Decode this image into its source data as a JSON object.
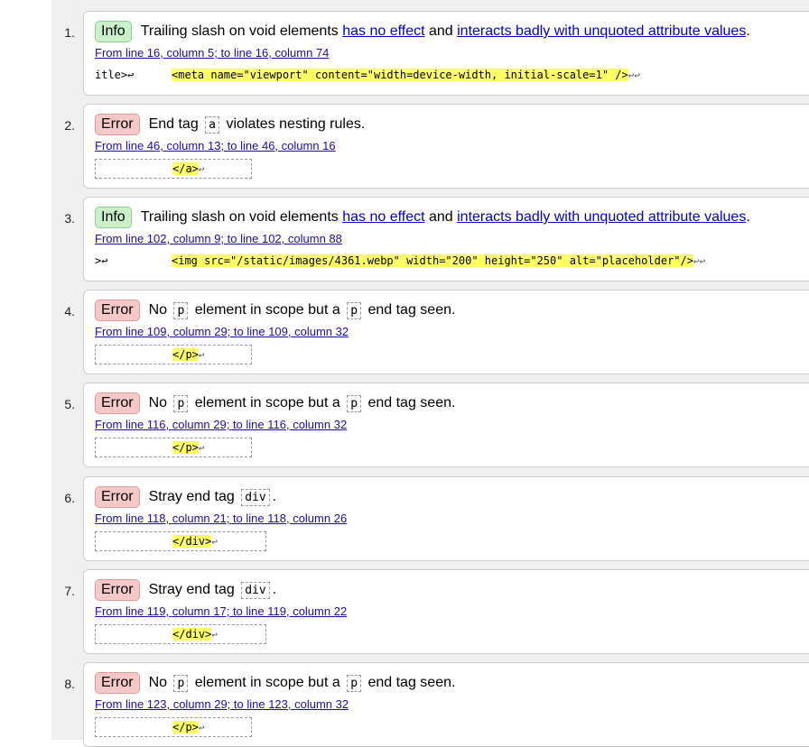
{
  "messages": [
    {
      "num": "1.",
      "type": "Info",
      "parts": [
        {
          "t": "Trailing slash on void elements "
        },
        {
          "t": "has no effect",
          "link": true
        },
        {
          "t": " and "
        },
        {
          "t": "interacts badly with unquoted attribute values",
          "link": true
        },
        {
          "t": "."
        }
      ],
      "location": "From line 16, column 5; to line 16, column 74",
      "pre": "itle>↩",
      "code": "<meta name=\"viewport\" content=\"width=device-width, initial-scale=1\" />",
      "post": "↩↩"
    },
    {
      "num": "2.",
      "type": "Error",
      "parts": [
        {
          "t": "End tag "
        },
        {
          "t": "a",
          "code": true
        },
        {
          "t": " violates nesting rules."
        }
      ],
      "location": "From line 46, column 13; to line 46, column 16",
      "pre": "",
      "code": "</a>",
      "post": "↩"
    },
    {
      "num": "3.",
      "type": "Info",
      "parts": [
        {
          "t": "Trailing slash on void elements "
        },
        {
          "t": "has no effect",
          "link": true
        },
        {
          "t": " and "
        },
        {
          "t": "interacts badly with unquoted attribute values",
          "link": true
        },
        {
          "t": "."
        }
      ],
      "location": "From line 102, column 9; to line 102, column 88",
      "pre": ">↩",
      "code": "<img src=\"/static/images/4361.webp\" width=\"200\" height=\"250\" alt=\"placeholder\"/>",
      "post": "↩↩"
    },
    {
      "num": "4.",
      "type": "Error",
      "parts": [
        {
          "t": "No "
        },
        {
          "t": "p",
          "code": true
        },
        {
          "t": " element in scope but a "
        },
        {
          "t": "p",
          "code": true
        },
        {
          "t": " end tag seen."
        }
      ],
      "location": "From line 109, column 29; to line 109, column 32",
      "pre": "",
      "code": "</p>",
      "post": "↩"
    },
    {
      "num": "5.",
      "type": "Error",
      "parts": [
        {
          "t": "No "
        },
        {
          "t": "p",
          "code": true
        },
        {
          "t": " element in scope but a "
        },
        {
          "t": "p",
          "code": true
        },
        {
          "t": " end tag seen."
        }
      ],
      "location": "From line 116, column 29; to line 116, column 32",
      "pre": "",
      "code": "</p>",
      "post": "↩"
    },
    {
      "num": "6.",
      "type": "Error",
      "parts": [
        {
          "t": "Stray end tag "
        },
        {
          "t": "div",
          "code": true
        },
        {
          "t": "."
        }
      ],
      "location": "From line 118, column 21; to line 118, column 26",
      "pre": "",
      "code": "</div>",
      "post": "↩"
    },
    {
      "num": "7.",
      "type": "Error",
      "parts": [
        {
          "t": "Stray end tag "
        },
        {
          "t": "div",
          "code": true
        },
        {
          "t": "."
        }
      ],
      "location": "From line 119, column 17; to line 119, column 22",
      "pre": "",
      "code": "</div>",
      "post": "↩"
    },
    {
      "num": "8.",
      "type": "Error",
      "parts": [
        {
          "t": "No "
        },
        {
          "t": "p",
          "code": true
        },
        {
          "t": " element in scope but a "
        },
        {
          "t": "p",
          "code": true
        },
        {
          "t": " end tag seen."
        }
      ],
      "location": "From line 123, column 29; to line 123, column 32",
      "pre": "",
      "code": "</p>",
      "post": "↩"
    }
  ]
}
